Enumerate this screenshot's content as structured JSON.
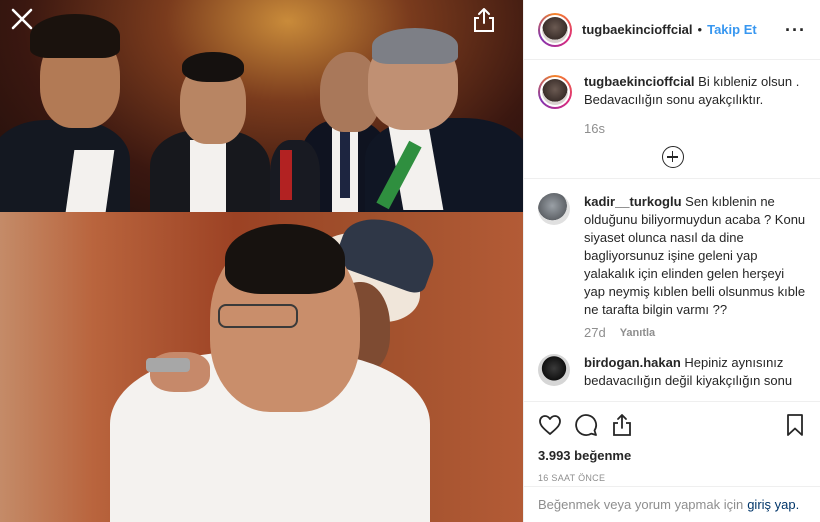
{
  "post": {
    "username": "tugbaekincioffcial",
    "follow_label": "Takip Et",
    "separator": "•",
    "more_label": "···",
    "caption_username": "tugbaekincioffcial",
    "caption_text": "Bi kıbleniz olsun . Bedavacılığın sonu ayakçılıktır.",
    "caption_time": "16s",
    "likes": "3.993 beğenme",
    "posted_time": "16 SAAT ÖNCE"
  },
  "comments": [
    {
      "username": "kadir__turkoglu",
      "text": "Sen kıblenin ne olduğunu biliyormuydun acaba ? Konu siyaset olunca nasıl da dine bagliyorsunuz işine geleni yap yalakalık için elinden gelen herşeyi yap neymiş kıblen belli olsunmus kıble ne tarafta bilgin varmı ??",
      "time": "27d",
      "reply_label": "Yanıtla"
    },
    {
      "username": "birdogan.hakan",
      "text": "Hepiniz aynısınız bedavacılığın değil kiyakçılığın sonu",
      "time": "",
      "reply_label": ""
    }
  ],
  "login": {
    "prompt": "Beğenmek veya yorum yapmak için",
    "link": "giriş yap."
  },
  "icons": {
    "close": "close-icon",
    "share": "share-icon",
    "more": "more-icon",
    "load_more": "plus-circle-icon",
    "like": "heart-icon",
    "comment": "comment-icon",
    "send": "share-icon",
    "save": "bookmark-icon"
  },
  "colors": {
    "accent": "#3897f0",
    "link": "#003569",
    "muted": "#8e8e8e"
  }
}
